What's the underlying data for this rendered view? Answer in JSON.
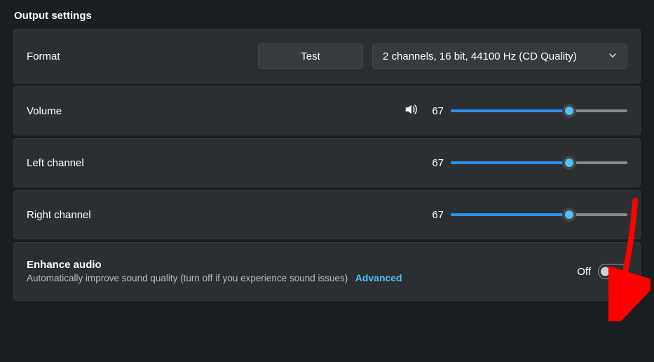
{
  "title": "Output settings",
  "format": {
    "label": "Format",
    "test_button": "Test",
    "selected": "2 channels, 16 bit, 44100 Hz (CD Quality)"
  },
  "volume": {
    "label": "Volume",
    "value": "67",
    "percent": 67
  },
  "left_channel": {
    "label": "Left channel",
    "value": "67",
    "percent": 67
  },
  "right_channel": {
    "label": "Right channel",
    "value": "67",
    "percent": 67
  },
  "enhance": {
    "title": "Enhance audio",
    "subtitle": "Automatically improve sound quality (turn off if you experience sound issues)",
    "advanced_link": "Advanced",
    "state_label": "Off",
    "on": false
  }
}
